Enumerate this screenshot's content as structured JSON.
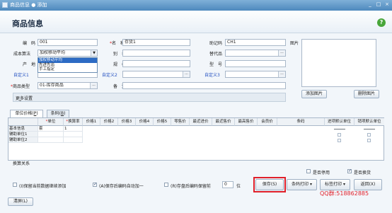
{
  "window": {
    "title": "商品信息 ● 添加",
    "min": "_",
    "max": "□",
    "close": "×"
  },
  "header": {
    "title": "商品信息",
    "help": "?"
  },
  "form": {
    "code": {
      "label": "编　码",
      "value": "001"
    },
    "name": {
      "label": "名　称",
      "value": "存货1",
      "required": "*"
    },
    "mnemonic": {
      "label": "助记码",
      "value": "CH1"
    },
    "image_label": "图片",
    "cost_method": {
      "label": "成本算法",
      "value": "加权移动平均",
      "options": [
        "加权移动平均",
        "先进先出",
        "手工指定"
      ]
    },
    "alias": {
      "label": "别　名",
      "value": ""
    },
    "substitute": {
      "label": "替代品",
      "value": ""
    },
    "origin": {
      "label": "产　地",
      "value": ""
    },
    "spec": {
      "label": "规　格",
      "value": ""
    },
    "model": {
      "label": "型　号",
      "value": ""
    },
    "custom1": {
      "label": "自定义1",
      "value": ""
    },
    "custom2": {
      "label": "自定义2",
      "value": ""
    },
    "custom3": {
      "label": "自定义3",
      "value": ""
    },
    "category": {
      "label": "商品类型",
      "value": "01-库存商品",
      "required": "*"
    },
    "remark": {
      "label": "备　注",
      "value": ""
    }
  },
  "image_buttons": {
    "add": "添加图片",
    "delete": "删除图片"
  },
  "more_settings": "更多设置",
  "tabs": [
    "单位价格",
    "条码"
  ],
  "grid": {
    "headers": [
      "",
      "单位",
      "换算率",
      "价格1",
      "价格2",
      "价格3",
      "价格4",
      "价格5",
      "零售价",
      "最近进价",
      "最近售价",
      "最高售价",
      "会员价",
      "条码",
      "进项默认单位",
      "销项默认单位"
    ],
    "required_marks": [
      "*",
      "*"
    ],
    "rows": [
      {
        "name": "基本信息",
        "unit": "套",
        "rate": "1"
      },
      {
        "name": "辅助单位1",
        "unit": "",
        "rate": ""
      },
      {
        "name": "辅助单位2",
        "unit": "",
        "rate": ""
      }
    ]
  },
  "conversion_label": "换算关系",
  "stop_use": {
    "label": "是否停用",
    "checked": false
  },
  "check_stock": {
    "label": "是否换货",
    "checked": true
  },
  "options": {
    "keep_data": "保留当前数据继续添加",
    "keep_data_key": "(I)",
    "auto_code": "保存后编码自动加一",
    "auto_code_key": "(A)",
    "keep_code": "存盘后编码保留前",
    "keep_code_key": "(R)",
    "keep_code_count": "0",
    "keep_code_unit": "位"
  },
  "footer": {
    "clear": "清屏(L)",
    "save": "保存(S)",
    "barcode_print": "条码打印",
    "label_print": "标签打印",
    "back": "返回(X)",
    "watermark": "QQ群:518862885"
  }
}
